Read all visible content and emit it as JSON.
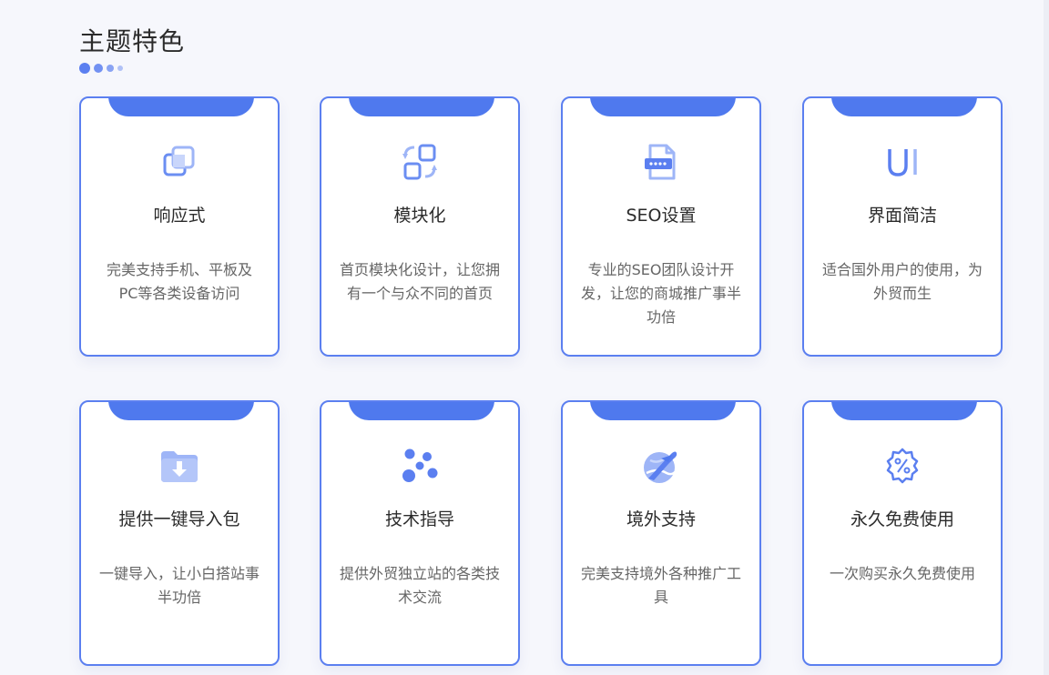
{
  "section": {
    "title": "主题特色"
  },
  "features": [
    {
      "icon": "responsive-icon",
      "title": "响应式",
      "desc": "完美支持手机、平板及PC等各类设备访问"
    },
    {
      "icon": "modules-icon",
      "title": "模块化",
      "desc": "首页模块化设计，让您拥有一个与众不同的首页"
    },
    {
      "icon": "seo-icon",
      "title": "SEO设置",
      "desc": "专业的SEO团队设计开发，让您的商城推广事半功倍"
    },
    {
      "icon": "ui-icon",
      "title": "界面简洁",
      "icon_text": "UI",
      "desc": "适合国外用户的使用，为外贸而生"
    },
    {
      "icon": "folder-download-icon",
      "title": "提供一键导入包",
      "desc": "一键导入，让小白搭站事半功倍"
    },
    {
      "icon": "molecule-icon",
      "title": "技术指导",
      "desc": "提供外贸独立站的各类技术交流"
    },
    {
      "icon": "airplane-globe-icon",
      "title": "境外支持",
      "desc": "完美支持境外各种推广工具"
    },
    {
      "icon": "discount-badge-icon",
      "title": "永久免费使用",
      "icon_text": "%",
      "desc": "一次购买永久免费使用"
    }
  ],
  "colors": {
    "accent": "#5b7ff0",
    "tab": "#4f79ee",
    "background": "#f6f7fc",
    "card": "#ffffff"
  }
}
